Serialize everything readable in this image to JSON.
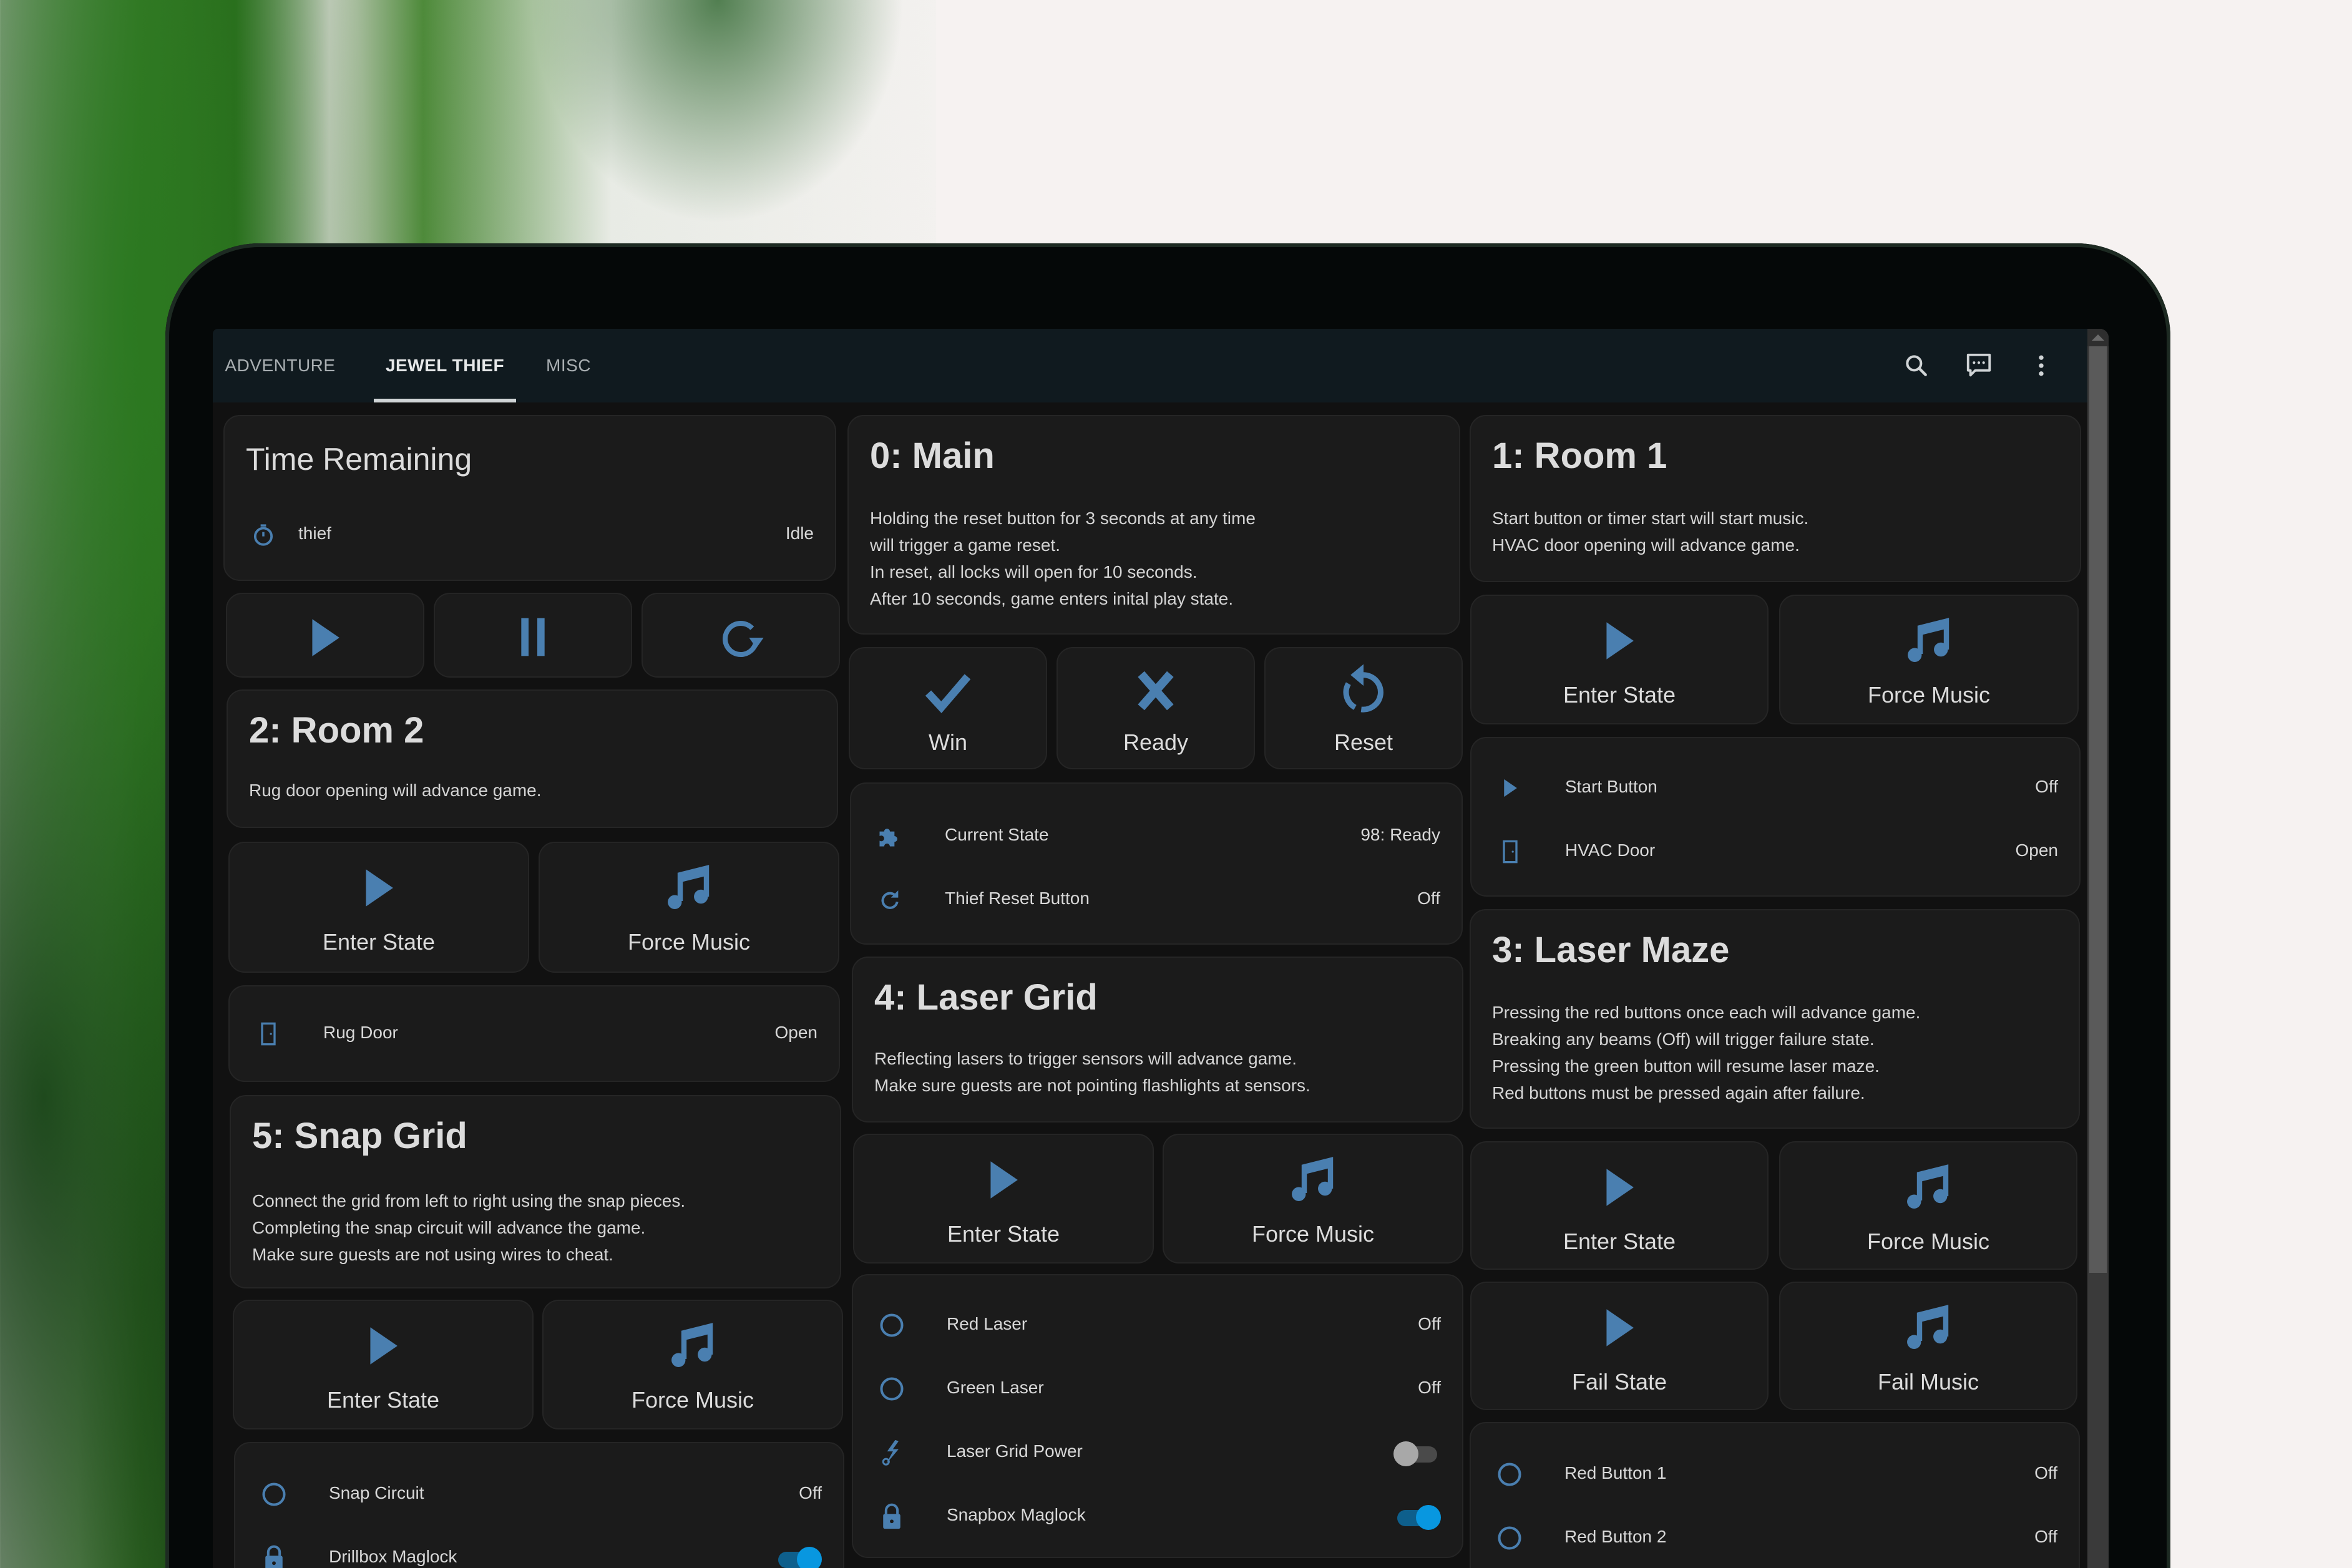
{
  "colors": {
    "accent_icon": "#4a7fb0",
    "toggle_on": "#0897e0",
    "toggle_off": "#a8a8a8",
    "card_bg": "#1b1b1b",
    "header_bg": "#101a1f",
    "text": "#dcdcdc"
  },
  "tabs": [
    {
      "label": "ADVENTURE",
      "active": false
    },
    {
      "label": "JEWEL THIEF",
      "active": true
    },
    {
      "label": "MISC",
      "active": false
    }
  ],
  "header_icons": [
    "search-icon",
    "chat-icon",
    "more-vert-icon"
  ],
  "timer": {
    "title": "Time Remaining",
    "entity_icon": "timer-icon",
    "entity_name": "thief",
    "entity_state": "Idle",
    "controls": [
      {
        "icon": "play-icon",
        "action": "start"
      },
      {
        "icon": "pause-icon",
        "action": "pause"
      },
      {
        "icon": "restart-icon",
        "action": "reset"
      }
    ]
  },
  "main": {
    "title": "0: Main",
    "description": "Holding the reset button for 3 seconds at any time\nwill trigger a game reset.\nIn reset, all locks will open for 10 seconds.\nAfter 10 seconds, game enters inital play state.",
    "buttons": [
      {
        "label": "Win",
        "icon": "check-icon"
      },
      {
        "label": "Ready",
        "icon": "close-icon"
      },
      {
        "label": "Reset",
        "icon": "restore-icon"
      }
    ],
    "entities": [
      {
        "icon": "puzzle-icon",
        "name": "Current State",
        "state": "98: Ready"
      },
      {
        "icon": "refresh-icon",
        "name": "Thief Reset Button",
        "state": "Off"
      }
    ]
  },
  "room1": {
    "title": "1: Room 1",
    "description": "Start button or timer start will start music.\nHVAC door opening will advance game.",
    "buttons": [
      {
        "label": "Enter State",
        "icon": "play-icon"
      },
      {
        "label": "Force Music",
        "icon": "music-icon"
      }
    ],
    "entities": [
      {
        "icon": "play-icon",
        "name": "Start Button",
        "state": "Off"
      },
      {
        "icon": "door-icon",
        "name": "HVAC Door",
        "state": "Open"
      }
    ]
  },
  "room2": {
    "title": "2: Room 2",
    "description": "Rug door opening will advance game.",
    "buttons": [
      {
        "label": "Enter State",
        "icon": "play-icon"
      },
      {
        "label": "Force Music",
        "icon": "music-icon"
      }
    ],
    "entities": [
      {
        "icon": "door-icon",
        "name": "Rug Door",
        "state": "Open"
      }
    ]
  },
  "laser_maze": {
    "title": "3: Laser Maze",
    "description": "Pressing the red buttons once each will advance game.\nBreaking any beams (Off) will trigger failure state.\nPressing the green button will resume laser maze.\nRed buttons must be pressed again after failure.",
    "buttons": [
      {
        "label": "Enter State",
        "icon": "play-icon"
      },
      {
        "label": "Force Music",
        "icon": "music-icon"
      },
      {
        "label": "Fail State",
        "icon": "play-icon"
      },
      {
        "label": "Fail Music",
        "icon": "music-icon"
      }
    ],
    "entities": [
      {
        "icon": "circle-outline-icon",
        "name": "Red Button 1",
        "state": "Off"
      },
      {
        "icon": "circle-outline-icon",
        "name": "Red Button 2",
        "state": "Off"
      }
    ]
  },
  "laser_grid": {
    "title": "4: Laser Grid",
    "description": "Reflecting lasers to trigger sensors will advance game.\nMake sure guests are not pointing flashlights at sensors.",
    "buttons": [
      {
        "label": "Enter State",
        "icon": "play-icon"
      },
      {
        "label": "Force Music",
        "icon": "music-icon"
      }
    ],
    "entities": [
      {
        "icon": "circle-outline-icon",
        "name": "Red Laser",
        "state": "Off"
      },
      {
        "icon": "circle-outline-icon",
        "name": "Green Laser",
        "state": "Off"
      },
      {
        "icon": "power-plug-icon",
        "name": "Laser Grid Power",
        "toggle": false
      },
      {
        "icon": "lock-icon",
        "name": "Snapbox Maglock",
        "toggle": true
      }
    ]
  },
  "snap_grid": {
    "title": "5: Snap Grid",
    "description": "Connect the grid from left to right using the snap pieces.\nCompleting the snap circuit will advance the game.\nMake sure guests are not using wires to cheat.",
    "buttons": [
      {
        "label": "Enter State",
        "icon": "play-icon"
      },
      {
        "label": "Force Music",
        "icon": "music-icon"
      }
    ],
    "entities": [
      {
        "icon": "circle-outline-icon",
        "name": "Snap Circuit",
        "state": "Off"
      },
      {
        "icon": "lock-icon",
        "name": "Drillbox Maglock",
        "toggle": true
      }
    ]
  }
}
